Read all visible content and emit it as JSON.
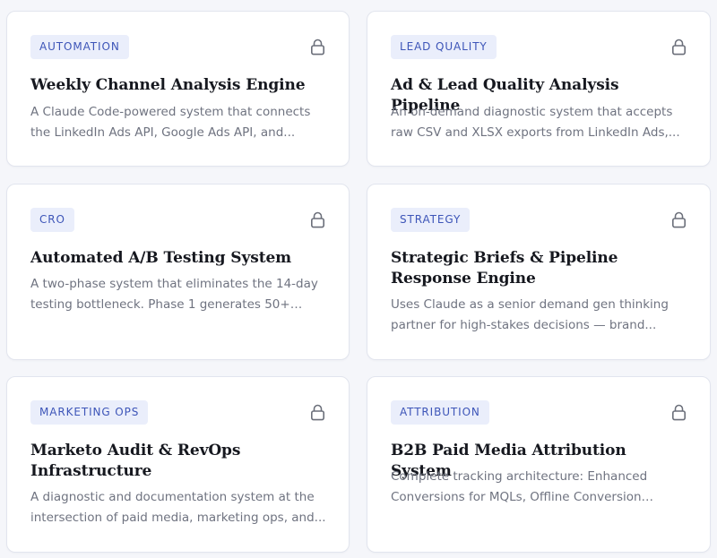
{
  "cards": [
    {
      "tag": "AUTOMATION",
      "title": "Weekly Channel Analysis Engine",
      "description": "A Claude Code-powered system that connects the LinkedIn Ads API, Google Ads API, and...",
      "icon": "lock-icon"
    },
    {
      "tag": "LEAD QUALITY",
      "title": "Ad & Lead Quality Analysis Pipeline",
      "description": "An on-demand diagnostic system that accepts raw CSV and XLSX exports from LinkedIn Ads,...",
      "icon": "lock-icon"
    },
    {
      "tag": "CRO",
      "title": "Automated A/B Testing System",
      "description": "A two-phase system that eliminates the 14-day testing bottleneck. Phase 1 generates 50+ copy...",
      "icon": "lock-icon"
    },
    {
      "tag": "STRATEGY",
      "title": "Strategic Briefs & Pipeline Response Engine",
      "description": "Uses Claude as a senior demand gen thinking partner for high-stakes decisions — brand...",
      "icon": "lock-icon"
    },
    {
      "tag": "MARKETING OPS",
      "title": "Marketo Audit & RevOps Infrastructure",
      "description": "A diagnostic and documentation system at the intersection of paid media, marketing ops, and...",
      "icon": "lock-icon"
    },
    {
      "tag": "ATTRIBUTION",
      "title": "B2B Paid Media Attribution System",
      "description": "Complete tracking architecture: Enhanced Conversions for MQLs, Offline Conversion Impor...",
      "icon": "lock-icon"
    }
  ],
  "colors": {
    "tag_bg": "#eaeefb",
    "tag_text": "#3d55b8",
    "title": "#16181f",
    "description": "#6f7380",
    "lock": "#6b6f7a",
    "page_bg": "#f5f6fa"
  }
}
